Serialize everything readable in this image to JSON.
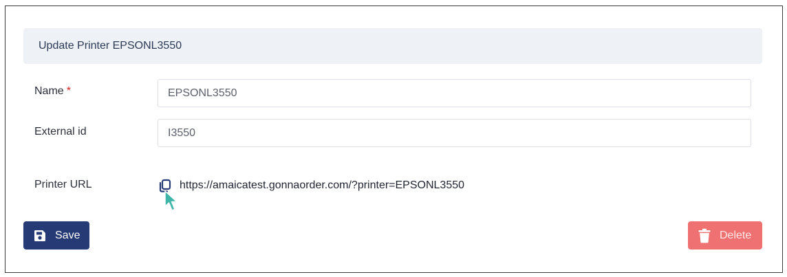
{
  "header": {
    "title": "Update Printer EPSONL3550"
  },
  "form": {
    "name": {
      "label": "Name",
      "required_mark": "*",
      "value": "EPSONL3550"
    },
    "external_id": {
      "label": "External id",
      "value": "I3550"
    },
    "printer_url": {
      "label": "Printer URL",
      "value": "https://amaicatest.gonnaorder.com/?printer=EPSONL3550"
    }
  },
  "actions": {
    "save_label": "Save",
    "delete_label": "Delete"
  },
  "colors": {
    "primary": "#263a75",
    "danger": "#f07171",
    "header_bg": "#eef1f5",
    "required": "#d42020",
    "cursor": "#3fb5a8"
  },
  "icons": {
    "copy": "copy-icon",
    "save": "floppy-disk-icon",
    "delete": "trash-icon",
    "cursor": "mouse-pointer-icon"
  }
}
